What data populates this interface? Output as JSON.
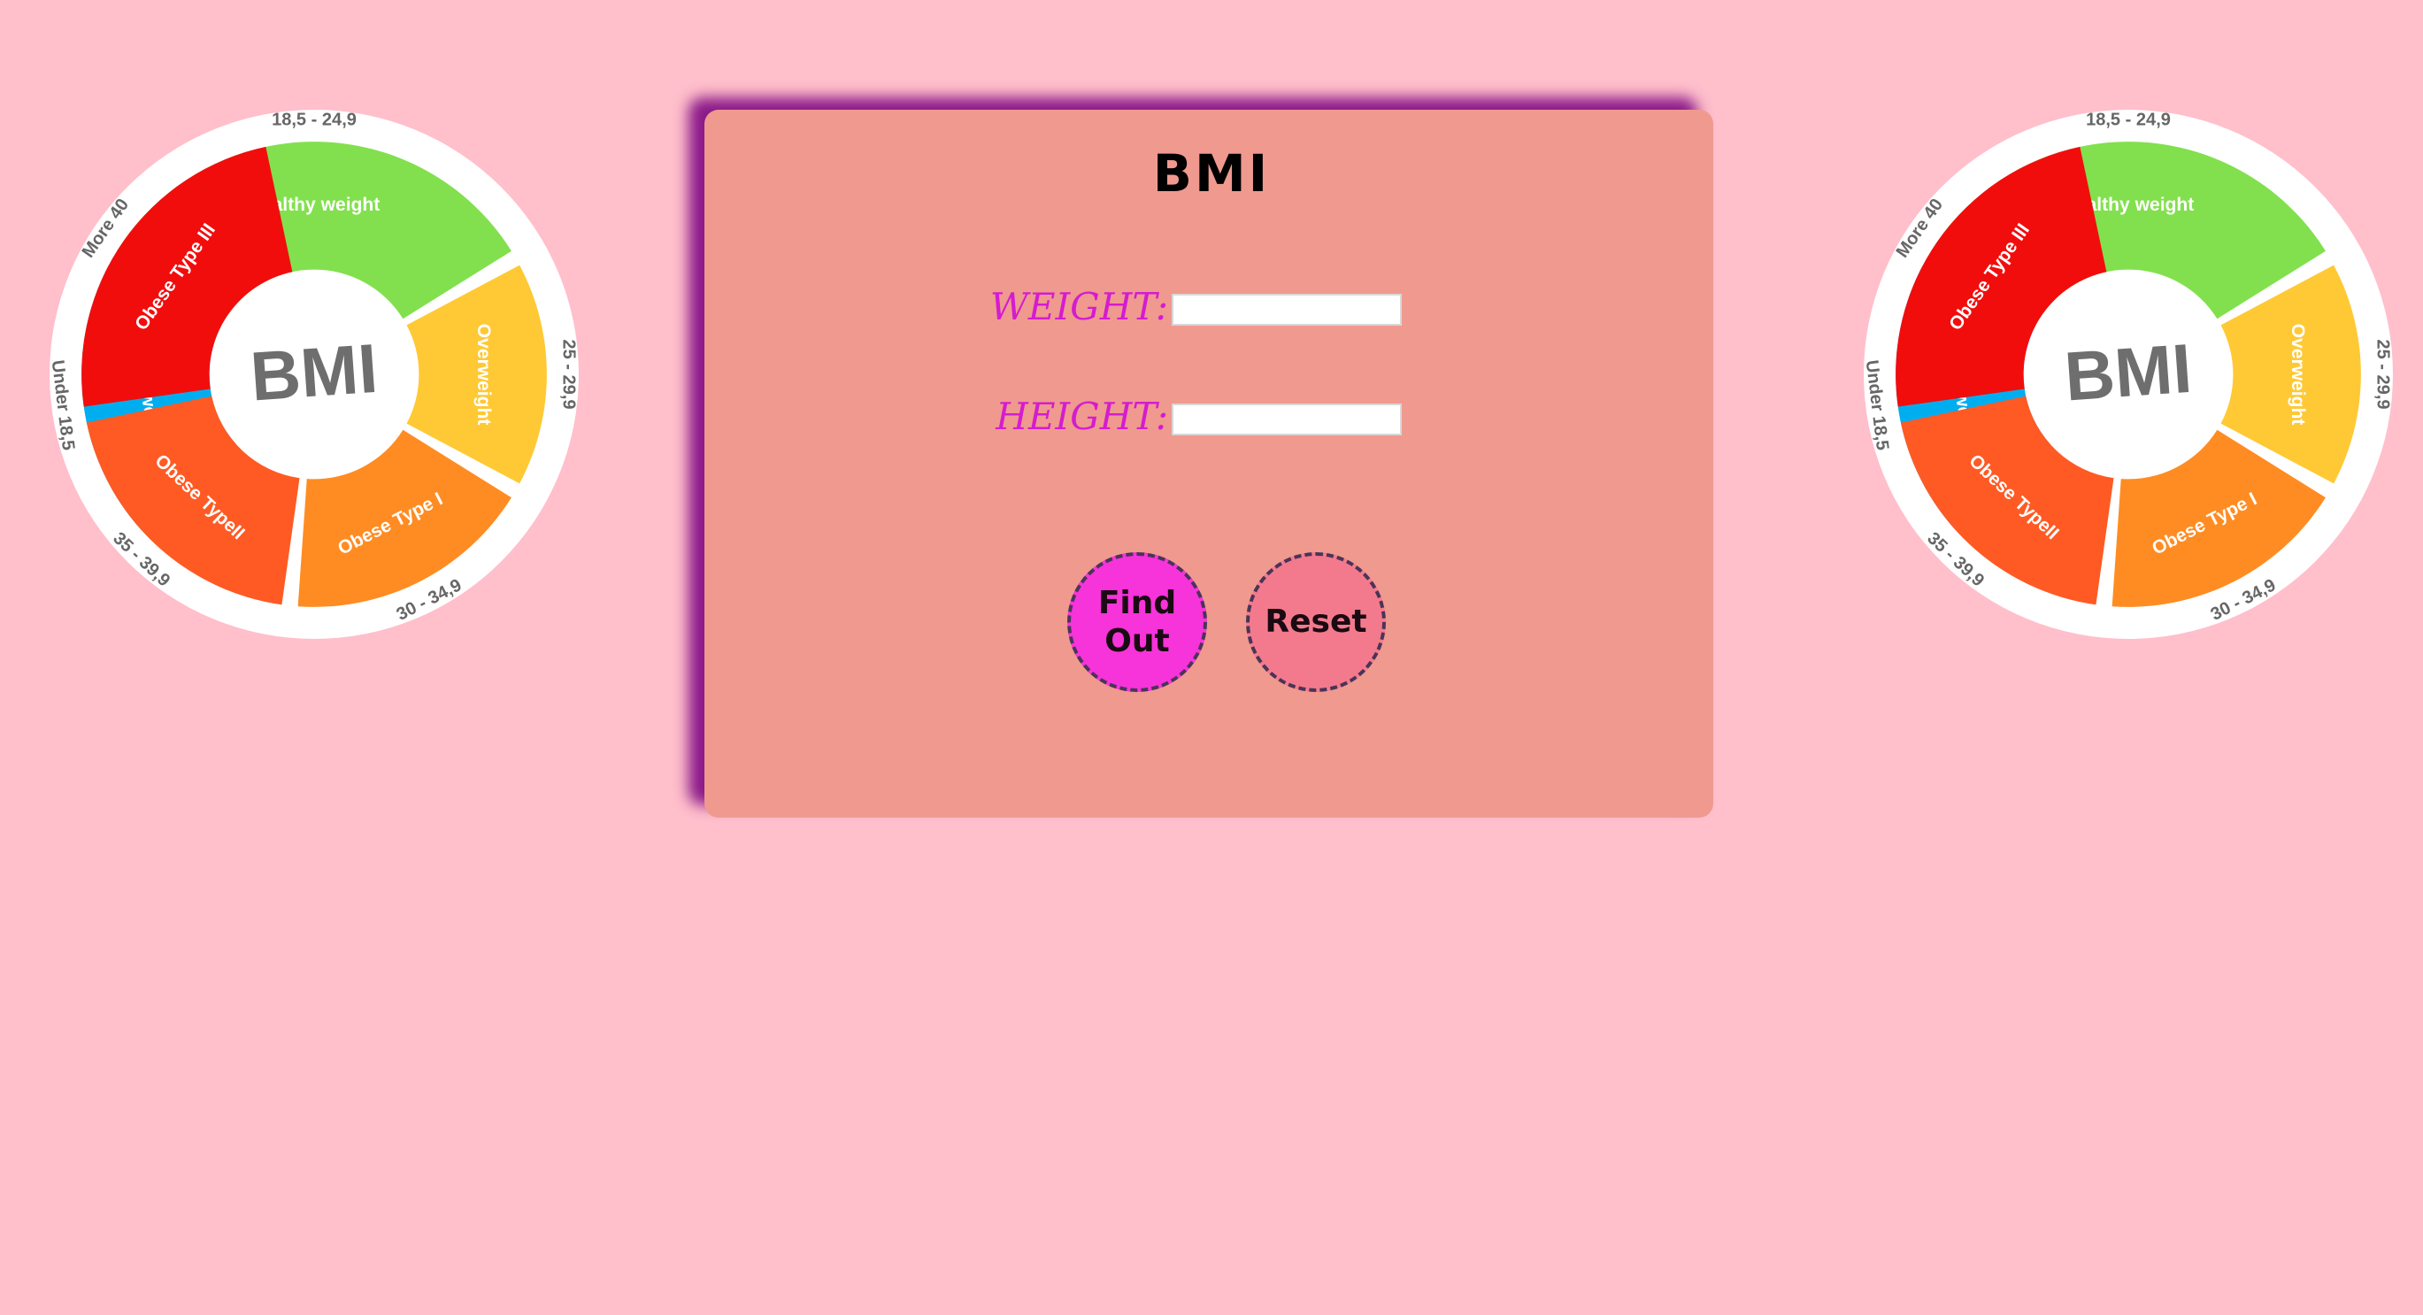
{
  "form": {
    "title": "BMI",
    "weight_label": "WEIGHT:",
    "weight_value": "",
    "height_label": "HEIGHT:",
    "height_value": "",
    "find_out_label": "Find Out",
    "reset_label": "Reset"
  },
  "bmi_wheel": {
    "center_label": "BMI",
    "segments": [
      {
        "name": "Underweight",
        "range": "Under 18,5",
        "color": "#00aef0"
      },
      {
        "name": "Healthy weight",
        "range": "18,5 - 24,9",
        "color": "#82e04e"
      },
      {
        "name": "Overweight",
        "range": "25 - 29,9",
        "color": "#ffc935"
      },
      {
        "name": "Obese Type I",
        "range": "30 - 34,9",
        "color": "#ff8c22"
      },
      {
        "name": "Obese TypeII",
        "range": "35 - 39,9",
        "color": "#ff5a23"
      },
      {
        "name": "Obese Type III",
        "range": "More 40",
        "color": "#f20d0d"
      }
    ]
  },
  "colors": {
    "page_background": "#ffbfcb",
    "card_background": "#f0998f",
    "card_shadow": "#8c1a8a",
    "label_color": "#d41cd0",
    "find_out_button": "#f733da",
    "reset_button": "#f37a8c"
  }
}
